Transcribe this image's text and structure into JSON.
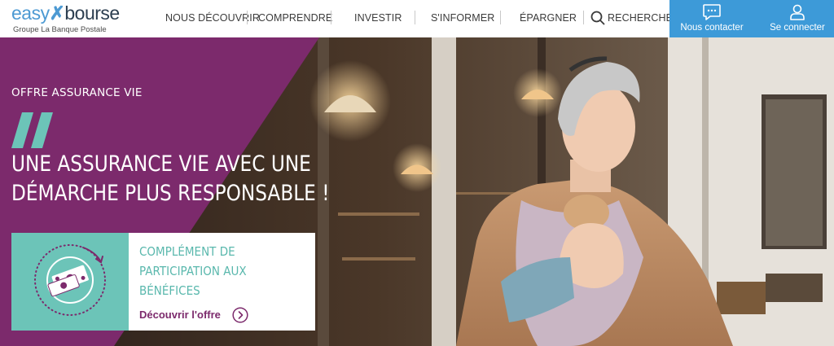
{
  "brand": {
    "logo_easy": "easy",
    "logo_bourse": "bourse",
    "logo_sub": "Groupe La Banque Postale"
  },
  "nav": {
    "items": [
      {
        "label": "NOUS DÉCOUVRIR"
      },
      {
        "label": "COMPRENDRE"
      },
      {
        "label": "INVESTIR"
      },
      {
        "label": "S'INFORMER"
      },
      {
        "label": "ÉPARGNER"
      },
      {
        "label": "RECHERCHER"
      }
    ],
    "contact_label": "Nous contacter",
    "login_label": "Se connecter"
  },
  "hero": {
    "eyebrow": "OFFRE ASSURANCE VIE",
    "title": "UNE ASSURANCE VIE AVEC UNE DÉMARCHE PLUS RESPONSABLE !",
    "card": {
      "title": "COMPLÉMENT DE PARTICIPATION AUX BÉNÉFICES",
      "link_label": "Découvrir l'offre"
    }
  },
  "colors": {
    "brand_blue": "#3d9ad8",
    "purple": "#7c2a6c",
    "teal": "#6cc4b8"
  },
  "icons": {
    "search": "search-icon",
    "contact": "chat-bubble-icon",
    "login": "user-icon",
    "arrow": "arrow-right-circle-icon",
    "quote": "quote-mark-icon"
  }
}
